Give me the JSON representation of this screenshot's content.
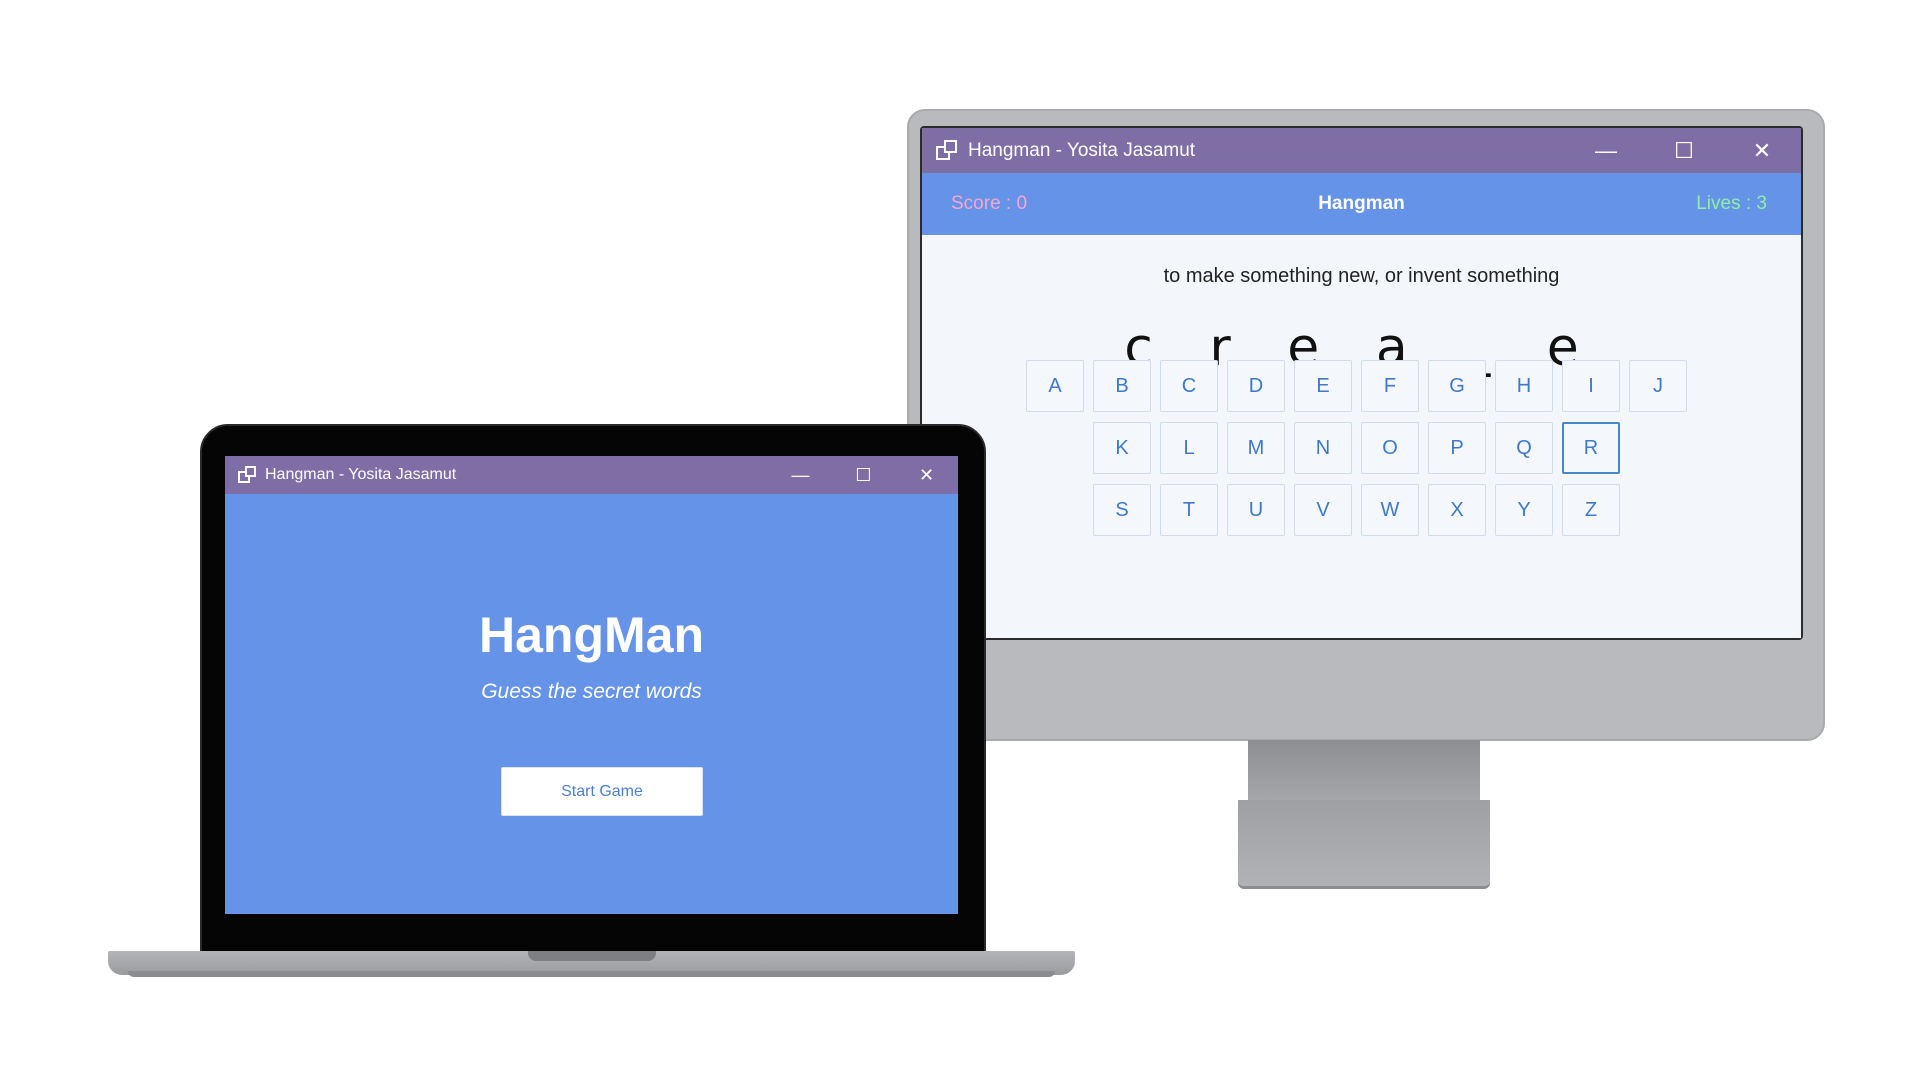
{
  "monitor_window": {
    "title": "Hangman - Yosita Jasamut",
    "controls": {
      "minimize": "—",
      "maximize": "☐",
      "close": "✕"
    },
    "header": {
      "score_text": "Score : 0",
      "title": "Hangman",
      "lives_text": "Lives : 3"
    },
    "hint": "to make something new, or invent something",
    "word_display": "c r e a _ e",
    "keyboard": {
      "rows": [
        [
          "A",
          "B",
          "C",
          "D",
          "E",
          "F",
          "G",
          "H",
          "I",
          "J"
        ],
        [
          "K",
          "L",
          "M",
          "N",
          "O",
          "P",
          "Q",
          "R"
        ],
        [
          "S",
          "T",
          "U",
          "V",
          "W",
          "X",
          "Y",
          "Z"
        ]
      ],
      "highlighted_key": "R"
    }
  },
  "laptop_window": {
    "title": "Hangman - Yosita Jasamut",
    "controls": {
      "minimize": "—",
      "maximize": "☐",
      "close": "✕"
    },
    "welcome_title": "HangMan",
    "welcome_subtitle": "Guess the secret words",
    "start_button_label": "Start Game"
  },
  "colors": {
    "titlebar": "#7f6ea6",
    "header_blue": "#6493e8",
    "score_pink": "#f5a7d4",
    "lives_green": "#8ef0a6",
    "key_text": "#3f78c8"
  },
  "icons": {
    "app_icon": "windows-overlap-icon",
    "minimize": "minimize-icon",
    "maximize": "maximize-icon",
    "close": "close-icon"
  }
}
